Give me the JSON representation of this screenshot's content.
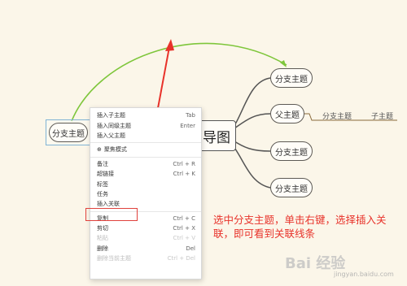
{
  "mindmap": {
    "central_title": "导图",
    "selected_topic": "分支主题",
    "topics": [
      "分支主题",
      "父主题",
      "分支主题",
      "分支主题"
    ],
    "subtopic_label": "分支主题",
    "child_label": "子主题"
  },
  "context_menu": {
    "items": [
      {
        "label": "插入子主题",
        "shortcut": "Tab"
      },
      {
        "label": "插入同级主题",
        "shortcut": "Enter"
      },
      {
        "label": "插入父主题",
        "shortcut": ""
      },
      {
        "label": "聚焦模式",
        "shortcut": ""
      },
      {
        "label": "备注",
        "shortcut": "Ctrl + R"
      },
      {
        "label": "超链接",
        "shortcut": "Ctrl + K"
      },
      {
        "label": "标签",
        "shortcut": ""
      },
      {
        "label": "任务",
        "shortcut": ""
      },
      {
        "label": "插入关联",
        "shortcut": ""
      },
      {
        "label": "复制",
        "shortcut": "Ctrl + C"
      },
      {
        "label": "剪切",
        "shortcut": "Ctrl + X"
      },
      {
        "label": "粘贴",
        "shortcut": "Ctrl + V"
      },
      {
        "label": "删除",
        "shortcut": "Del"
      },
      {
        "label": "删除当前主题",
        "shortcut": "Ctrl + Del"
      }
    ]
  },
  "annotation": "选中分支主题，单击右键，选择插入关联，即可看到关联线条",
  "watermark": "Bai 经验",
  "watermark_sub": "jingyan.baidu.com",
  "colors": {
    "relation_line": "#7ec63b",
    "arrow": "#e8322a",
    "highlight": "#e0413c",
    "background": "#fbf6e9"
  }
}
